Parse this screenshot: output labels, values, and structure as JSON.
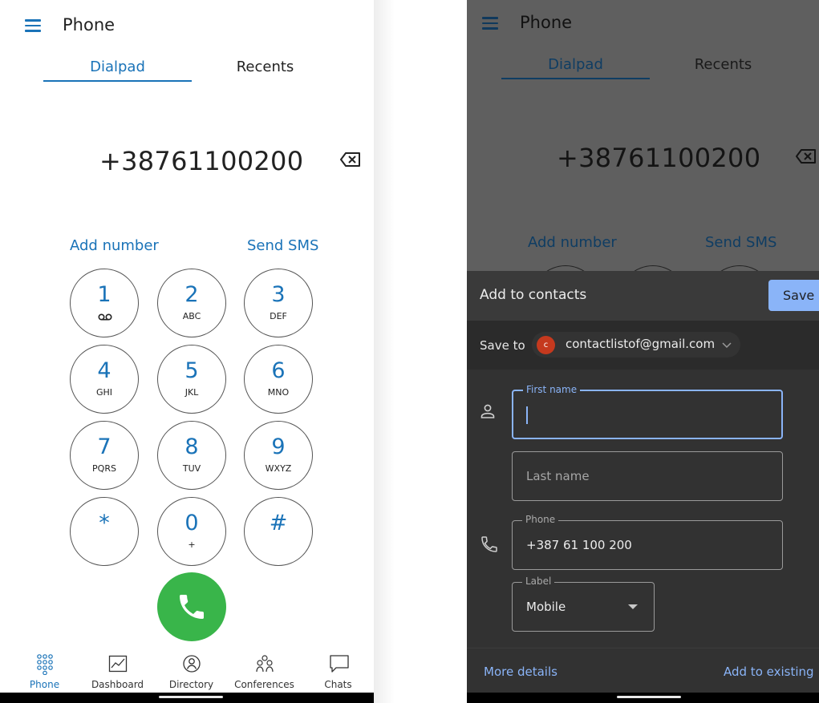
{
  "left": {
    "header": {
      "title": "Phone"
    },
    "tabs": [
      {
        "label": "Dialpad",
        "active": true
      },
      {
        "label": "Recents",
        "active": false
      }
    ],
    "dialed_number": "+38761100200",
    "actions": {
      "add_number": "Add number",
      "send_sms": "Send SMS"
    },
    "keypad": [
      {
        "digit": "1",
        "letters": ""
      },
      {
        "digit": "2",
        "letters": "ABC"
      },
      {
        "digit": "3",
        "letters": "DEF"
      },
      {
        "digit": "4",
        "letters": "GHI"
      },
      {
        "digit": "5",
        "letters": "JKL"
      },
      {
        "digit": "6",
        "letters": "MNO"
      },
      {
        "digit": "7",
        "letters": "PQRS"
      },
      {
        "digit": "8",
        "letters": "TUV"
      },
      {
        "digit": "9",
        "letters": "WXYZ"
      },
      {
        "digit": "*",
        "letters": ""
      },
      {
        "digit": "0",
        "letters": "+"
      },
      {
        "digit": "#",
        "letters": ""
      }
    ],
    "bottom_nav": [
      {
        "label": "Phone",
        "icon": "dialpad-icon",
        "active": true
      },
      {
        "label": "Dashboard",
        "icon": "chart-icon",
        "active": false
      },
      {
        "label": "Directory",
        "icon": "directory-icon",
        "active": false
      },
      {
        "label": "Conferences",
        "icon": "conference-icon",
        "active": false
      },
      {
        "label": "Chats",
        "icon": "chat-icon",
        "active": false
      }
    ]
  },
  "right": {
    "header": {
      "title": "Phone"
    },
    "tabs": [
      {
        "label": "Dialpad",
        "active": true
      },
      {
        "label": "Recents",
        "active": false
      }
    ],
    "dialed_number": "+38761100200",
    "actions": {
      "add_number": "Add number",
      "send_sms": "Send SMS"
    },
    "sheet": {
      "title": "Add to contacts",
      "save_label": "Save",
      "save_to_label": "Save to",
      "account_initial": "c",
      "account_email": "contactlistof@gmail.com",
      "first_name_label": "First name",
      "first_name_value": "",
      "last_name_placeholder": "Last name",
      "phone_label": "Phone",
      "phone_value": "+387 61 100 200",
      "type_label": "Label",
      "type_value": "Mobile",
      "more_details": "More details",
      "add_to_existing": "Add to existing"
    }
  },
  "colors": {
    "accent_blue": "#1a73b8",
    "call_green": "#39b54a",
    "dialog_blue": "#8ab4f8",
    "dim_overlay": "#5f5f5f",
    "sheet_bg": "#323232",
    "avatar_red": "#c5391e"
  }
}
